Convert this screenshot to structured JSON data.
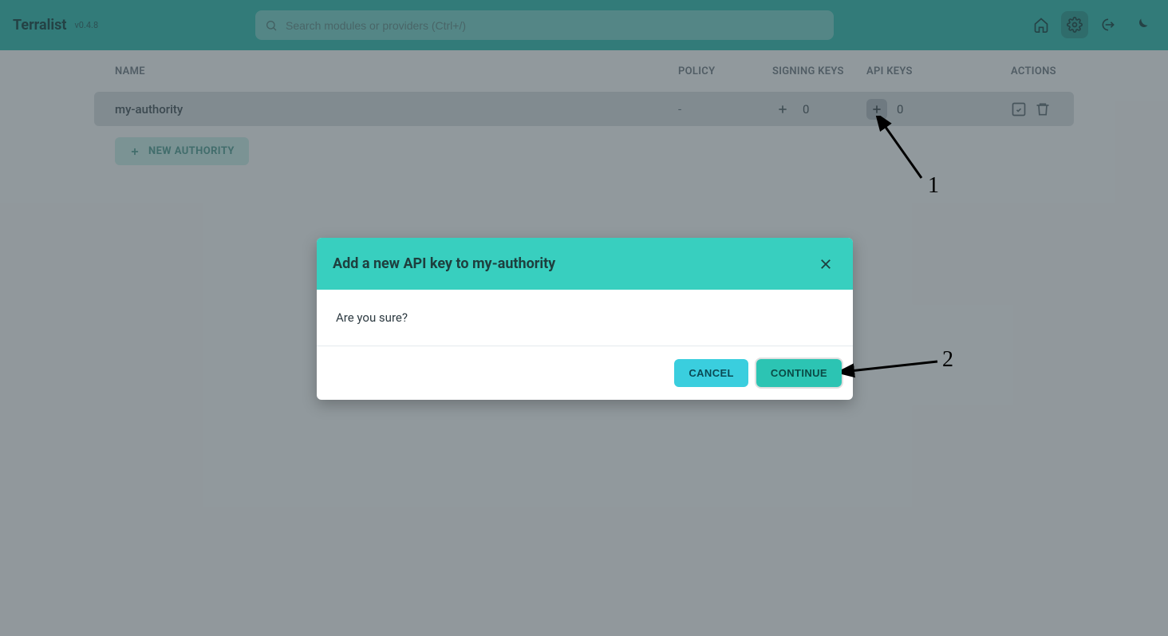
{
  "brand": {
    "name": "Terralist",
    "version": "v0.4.8"
  },
  "search": {
    "placeholder": "Search modules or providers (Ctrl+/)"
  },
  "nav_icons": {
    "home": "home-icon",
    "settings": "settings-icon",
    "logout": "logout-icon",
    "dark_mode": "dark-mode-icon"
  },
  "table": {
    "headers": {
      "name": "NAME",
      "policy": "POLICY",
      "signing_keys": "SIGNING KEYS",
      "api_keys": "API KEYS",
      "actions": "ACTIONS"
    },
    "rows": [
      {
        "name": "my-authority",
        "policy": "-",
        "signing_keys_count": "0",
        "api_keys_count": "0"
      }
    ],
    "new_authority_label": "NEW AUTHORITY"
  },
  "modal": {
    "title": "Add a new API key to my-authority",
    "body": "Are you sure?",
    "cancel": "CANCEL",
    "continue": "CONTINUE"
  },
  "annotations": {
    "label1": "1",
    "label2": "2"
  }
}
